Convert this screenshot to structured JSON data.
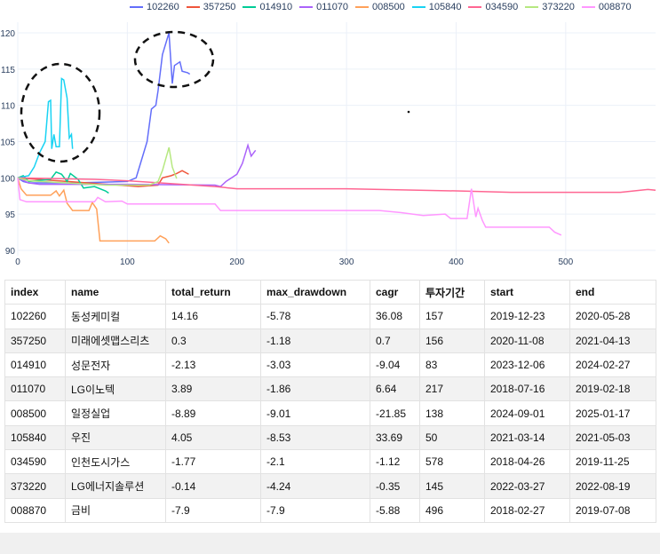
{
  "chart_data": {
    "type": "line",
    "xlim": [
      0,
      582
    ],
    "ylim": [
      90,
      121
    ],
    "xticks": [
      0,
      100,
      200,
      300,
      400,
      500
    ],
    "yticks": [
      90,
      95,
      100,
      105,
      110,
      115,
      120
    ],
    "legend_position": "top",
    "series": [
      {
        "name": "102260",
        "color": "#636efa",
        "points": [
          [
            0,
            100
          ],
          [
            5,
            99.5
          ],
          [
            10,
            99.3
          ],
          [
            50,
            99.3
          ],
          [
            100,
            99.5
          ],
          [
            108,
            100
          ],
          [
            112,
            102
          ],
          [
            118,
            105
          ],
          [
            122,
            109.5
          ],
          [
            126,
            110
          ],
          [
            128,
            112
          ],
          [
            132,
            117
          ],
          [
            138,
            120
          ],
          [
            141,
            113
          ],
          [
            143,
            115.5
          ],
          [
            148,
            116
          ],
          [
            150,
            114.7
          ],
          [
            155,
            114.5
          ],
          [
            157,
            114.3
          ]
        ]
      },
      {
        "name": "357250",
        "color": "#EF553B",
        "points": [
          [
            0,
            100
          ],
          [
            110,
            98.8
          ],
          [
            128,
            99
          ],
          [
            132,
            100
          ],
          [
            140,
            100.3
          ],
          [
            145,
            100.6
          ],
          [
            150,
            101
          ],
          [
            156,
            100.5
          ]
        ]
      },
      {
        "name": "014910",
        "color": "#00cc96",
        "points": [
          [
            0,
            100
          ],
          [
            5,
            100.3
          ],
          [
            10,
            99.5
          ],
          [
            30,
            99.8
          ],
          [
            35,
            100.8
          ],
          [
            40,
            100.5
          ],
          [
            45,
            99.5
          ],
          [
            48,
            100.6
          ],
          [
            55,
            99.8
          ],
          [
            60,
            98.6
          ],
          [
            70,
            98.8
          ],
          [
            80,
            98.2
          ],
          [
            83,
            97.9
          ]
        ]
      },
      {
        "name": "011070",
        "color": "#ab63fa",
        "points": [
          [
            0,
            100
          ],
          [
            10,
            99.3
          ],
          [
            20,
            99.1
          ],
          [
            100,
            99.1
          ],
          [
            180,
            99
          ],
          [
            185,
            98.8
          ],
          [
            190,
            99.5
          ],
          [
            195,
            100
          ],
          [
            200,
            100.5
          ],
          [
            205,
            102
          ],
          [
            210,
            104.5
          ],
          [
            213,
            103
          ],
          [
            217,
            103.8
          ]
        ]
      },
      {
        "name": "008500",
        "color": "#FFA15A",
        "points": [
          [
            0,
            100
          ],
          [
            3,
            98.5
          ],
          [
            8,
            97.6
          ],
          [
            30,
            97.6
          ],
          [
            35,
            98.2
          ],
          [
            38,
            97.5
          ],
          [
            42,
            98.3
          ],
          [
            45,
            96.5
          ],
          [
            50,
            95.5
          ],
          [
            65,
            95.5
          ],
          [
            68,
            96.6
          ],
          [
            72,
            95.7
          ],
          [
            75,
            91.3
          ],
          [
            125,
            91.3
          ],
          [
            130,
            92
          ],
          [
            135,
            91.6
          ],
          [
            138,
            91
          ]
        ]
      },
      {
        "name": "105840",
        "color": "#19d3f3",
        "points": [
          [
            0,
            100
          ],
          [
            10,
            100.3
          ],
          [
            15,
            101.5
          ],
          [
            20,
            103.5
          ],
          [
            25,
            105
          ],
          [
            28,
            110.5
          ],
          [
            30,
            110.7
          ],
          [
            31,
            104
          ],
          [
            33,
            106
          ],
          [
            35,
            104.3
          ],
          [
            38,
            104.3
          ],
          [
            40,
            113.7
          ],
          [
            42,
            113.5
          ],
          [
            45,
            111
          ],
          [
            47,
            105.5
          ],
          [
            49,
            106
          ],
          [
            50,
            104
          ]
        ]
      },
      {
        "name": "034590",
        "color": "#FF6692",
        "points": [
          [
            0,
            100
          ],
          [
            70,
            99.8
          ],
          [
            100,
            99.6
          ],
          [
            130,
            99.3
          ],
          [
            180,
            98.8
          ],
          [
            200,
            98.5
          ],
          [
            300,
            98.5
          ],
          [
            400,
            98.2
          ],
          [
            450,
            98
          ],
          [
            550,
            98
          ],
          [
            575,
            98.4
          ],
          [
            582,
            98.3
          ]
        ]
      },
      {
        "name": "373220",
        "color": "#B6E880",
        "points": [
          [
            0,
            100
          ],
          [
            10,
            99.6
          ],
          [
            80,
            99
          ],
          [
            120,
            99
          ],
          [
            128,
            99.5
          ],
          [
            132,
            101
          ],
          [
            138,
            104.2
          ],
          [
            141,
            101.5
          ],
          [
            145,
            99.9
          ]
        ]
      },
      {
        "name": "008870",
        "color": "#FF97FF",
        "points": [
          [
            0,
            100
          ],
          [
            2,
            97
          ],
          [
            8,
            96.7
          ],
          [
            70,
            96.7
          ],
          [
            73,
            97.3
          ],
          [
            80,
            96.7
          ],
          [
            95,
            96.8
          ],
          [
            100,
            96.4
          ],
          [
            180,
            96.4
          ],
          [
            185,
            95.5
          ],
          [
            330,
            95.5
          ],
          [
            350,
            95.2
          ],
          [
            370,
            94.8
          ],
          [
            390,
            95
          ],
          [
            395,
            94.4
          ],
          [
            410,
            94.4
          ],
          [
            414,
            98.5
          ],
          [
            418,
            94.6
          ],
          [
            420,
            95.8
          ],
          [
            424,
            94.1
          ],
          [
            427,
            93.2
          ],
          [
            485,
            93.2
          ],
          [
            490,
            92.5
          ],
          [
            496,
            92.1
          ]
        ]
      }
    ]
  },
  "table": {
    "headers": [
      "index",
      "name",
      "total_return",
      "max_drawdown",
      "cagr",
      "투자기간",
      "start",
      "end"
    ],
    "rows": [
      [
        "102260",
        "동성케미컬",
        "14.16",
        "-5.78",
        "36.08",
        "157",
        "2019-12-23",
        "2020-05-28"
      ],
      [
        "357250",
        "미래에셋맵스리츠",
        "0.3",
        "-1.18",
        "0.7",
        "156",
        "2020-11-08",
        "2021-04-13"
      ],
      [
        "014910",
        "성문전자",
        "-2.13",
        "-3.03",
        "-9.04",
        "83",
        "2023-12-06",
        "2024-02-27"
      ],
      [
        "011070",
        "LG이노텍",
        "3.89",
        "-1.86",
        "6.64",
        "217",
        "2018-07-16",
        "2019-02-18"
      ],
      [
        "008500",
        "일정실업",
        "-8.89",
        "-9.01",
        "-21.85",
        "138",
        "2024-09-01",
        "2025-01-17"
      ],
      [
        "105840",
        "우진",
        "4.05",
        "-8.53",
        "33.69",
        "50",
        "2021-03-14",
        "2021-05-03"
      ],
      [
        "034590",
        "인천도시가스",
        "-1.77",
        "-2.1",
        "-1.12",
        "578",
        "2018-04-26",
        "2019-11-25"
      ],
      [
        "373220",
        "LG에너지솔루션",
        "-0.14",
        "-4.24",
        "-0.35",
        "145",
        "2022-03-27",
        "2022-08-19"
      ],
      [
        "008870",
        "금비",
        "-7.9",
        "-7.9",
        "-5.88",
        "496",
        "2018-02-27",
        "2019-07-08"
      ]
    ]
  }
}
